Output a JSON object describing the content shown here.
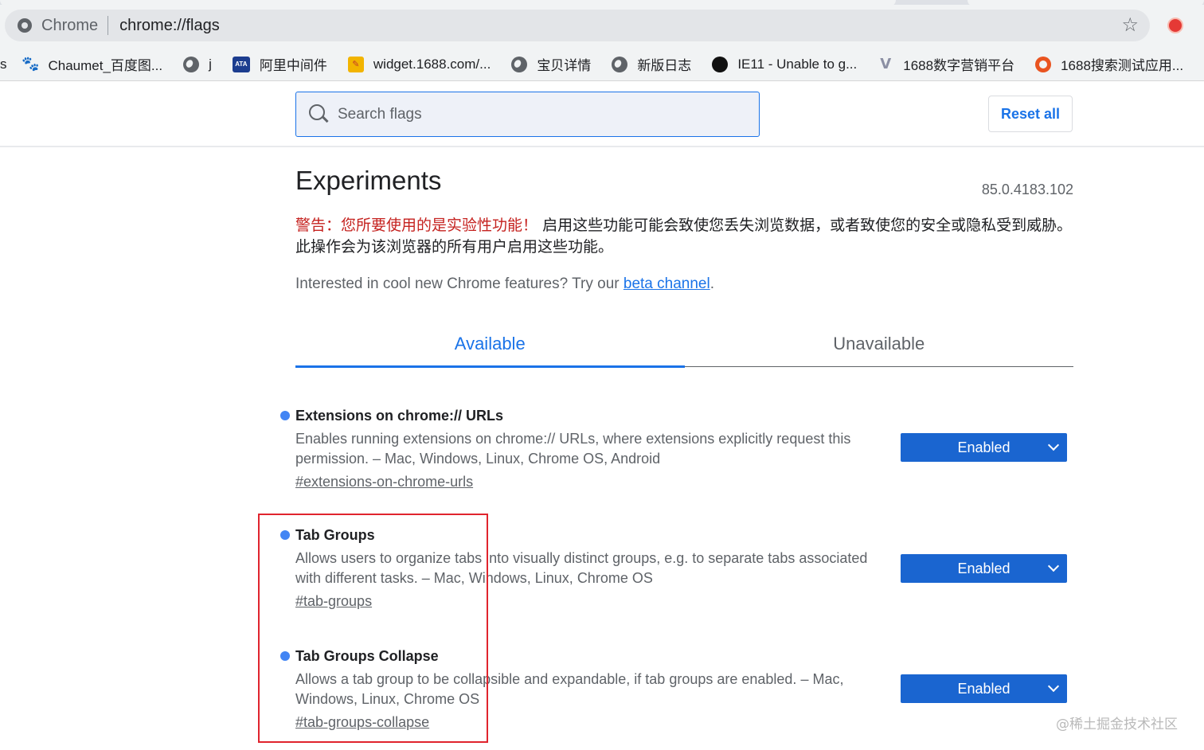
{
  "browser": {
    "omnibox": {
      "site_label": "Chrome",
      "url": "chrome://flags"
    },
    "bookmarks": [
      {
        "label": "s",
        "icon": "none"
      },
      {
        "label": "Chaumet_百度图...",
        "icon": "paw-icon"
      },
      {
        "label": "j",
        "icon": "globe-icon"
      },
      {
        "label": "阿里中间件",
        "icon": "ata-icon"
      },
      {
        "label": "widget.1688.com/...",
        "icon": "widget-icon"
      },
      {
        "label": "宝贝详情",
        "icon": "globe-icon"
      },
      {
        "label": "新版日志",
        "icon": "globe-icon"
      },
      {
        "label": "IE11 - Unable to g...",
        "icon": "github-icon"
      },
      {
        "label": "1688数字营销平台",
        "icon": "vlogo-icon"
      },
      {
        "label": "1688搜索测试应用...",
        "icon": "ubuntu-icon"
      }
    ]
  },
  "flags_header": {
    "search_placeholder": "Search flags",
    "reset_label": "Reset all"
  },
  "page": {
    "title": "Experiments",
    "version": "85.0.4183.102",
    "warning_red": "警告：您所要使用的是实验性功能！",
    "warning_rest": "启用这些功能可能会致使您丢失浏览数据，或者致使您的安全或隐私受到威胁。此操作会为该浏览器的所有用户启用这些功能。",
    "beta_prefix": "Interested in cool new Chrome features? Try our ",
    "beta_link": "beta channel",
    "beta_suffix": ".",
    "tabs": [
      {
        "label": "Available",
        "active": true
      },
      {
        "label": "Unavailable",
        "active": false
      }
    ]
  },
  "flags": [
    {
      "name": "Extensions on chrome:// URLs",
      "description": "Enables running extensions on chrome:// URLs, where extensions explicitly request this permission. – Mac, Windows, Linux, Chrome OS, Android",
      "link": "#extensions-on-chrome-urls",
      "value": "Enabled"
    },
    {
      "name": "Tab Groups",
      "description": "Allows users to organize tabs into visually distinct groups, e.g. to separate tabs associated with different tasks. – Mac, Windows, Linux, Chrome OS",
      "link": "#tab-groups",
      "value": "Enabled"
    },
    {
      "name": "Tab Groups Collapse",
      "description": "Allows a tab group to be collapsible and expandable, if tab groups are enabled. – Mac, Windows, Linux, Chrome OS",
      "link": "#tab-groups-collapse",
      "value": "Enabled"
    }
  ],
  "annotation": {
    "highlight_color": "#e0242d"
  },
  "watermark": "@稀土掘金技术社区",
  "colors": {
    "accent": "#1a73e8",
    "select_bg": "#1a65d0",
    "warning": "#c5221f"
  }
}
